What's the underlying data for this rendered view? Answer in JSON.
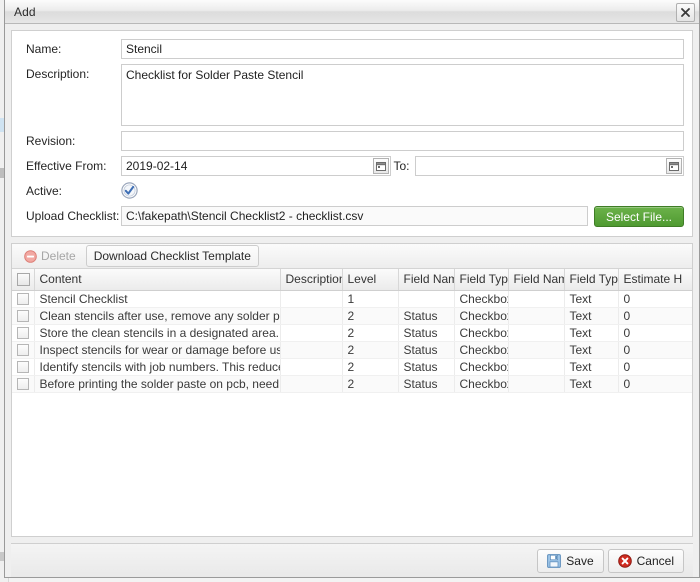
{
  "window": {
    "title": "Add",
    "close_icon": "close-icon"
  },
  "form": {
    "name": {
      "label": "Name:",
      "value": "Stencil"
    },
    "description": {
      "label": "Description:",
      "value": "Checklist for Solder Paste Stencil"
    },
    "revision": {
      "label": "Revision:",
      "value": ""
    },
    "effective_from": {
      "label": "Effective From:",
      "value": "2019-02-14",
      "calendar_icon": "calendar-icon"
    },
    "effective_to": {
      "separator_label": "To:",
      "value": "",
      "calendar_icon": "calendar-icon"
    },
    "active": {
      "label": "Active:",
      "checked": true,
      "icon": "check-circle-icon"
    },
    "upload_checklist": {
      "label": "Upload Checklist:",
      "value": "C:\\fakepath\\Stencil Checklist2 - checklist.csv",
      "button_label": "Select File..."
    }
  },
  "grid_toolbar": {
    "delete_label": "Delete",
    "delete_icon": "minus-circle-icon",
    "delete_disabled": true,
    "download_template_label": "Download Checklist Template"
  },
  "grid": {
    "columns": [
      "Content",
      "Description",
      "Level",
      "Field Name",
      "Field Type",
      "Field Name",
      "Field Type",
      "Estimate H"
    ],
    "rows": [
      {
        "content": "Stencil Checklist",
        "description": "",
        "level": "1",
        "field_name_1": "",
        "field_type_1": "Checkbox",
        "field_name_2": "",
        "field_type_2": "Text",
        "estimate": "0"
      },
      {
        "content": "Clean stencils after use, remove any solder paste o...",
        "description": "",
        "level": "2",
        "field_name_1": "Status",
        "field_type_1": "Checkbox",
        "field_name_2": "",
        "field_type_2": "Text",
        "estimate": "0"
      },
      {
        "content": "Store the clean stencils in a designated area. They ...",
        "description": "",
        "level": "2",
        "field_name_1": "Status",
        "field_type_1": "Checkbox",
        "field_name_2": "",
        "field_type_2": "Text",
        "estimate": "0"
      },
      {
        "content": "Inspect stencils for wear or damage before using th...",
        "description": "",
        "level": "2",
        "field_name_1": "Status",
        "field_type_1": "Checkbox",
        "field_name_2": "",
        "field_type_2": "Text",
        "estimate": "0"
      },
      {
        "content": "Identify stencils with job numbers. This reduce the ...",
        "description": "",
        "level": "2",
        "field_name_1": "Status",
        "field_type_1": "Checkbox",
        "field_name_2": "",
        "field_type_2": "Text",
        "estimate": "0"
      },
      {
        "content": "Before printing the solder paste on pcb, need to pla...",
        "description": "",
        "level": "2",
        "field_name_1": "Status",
        "field_type_1": "Checkbox",
        "field_name_2": "",
        "field_type_2": "Text",
        "estimate": "0"
      }
    ]
  },
  "footer": {
    "save_label": "Save",
    "save_icon": "floppy-disk-icon",
    "cancel_label": "Cancel",
    "cancel_icon": "cancel-circle-icon"
  },
  "colors": {
    "accent_green": "#5aa33a",
    "cancel_red": "#cf2b20",
    "save_blue": "#5f9ed6",
    "active_blue": "#3f6fb5"
  }
}
